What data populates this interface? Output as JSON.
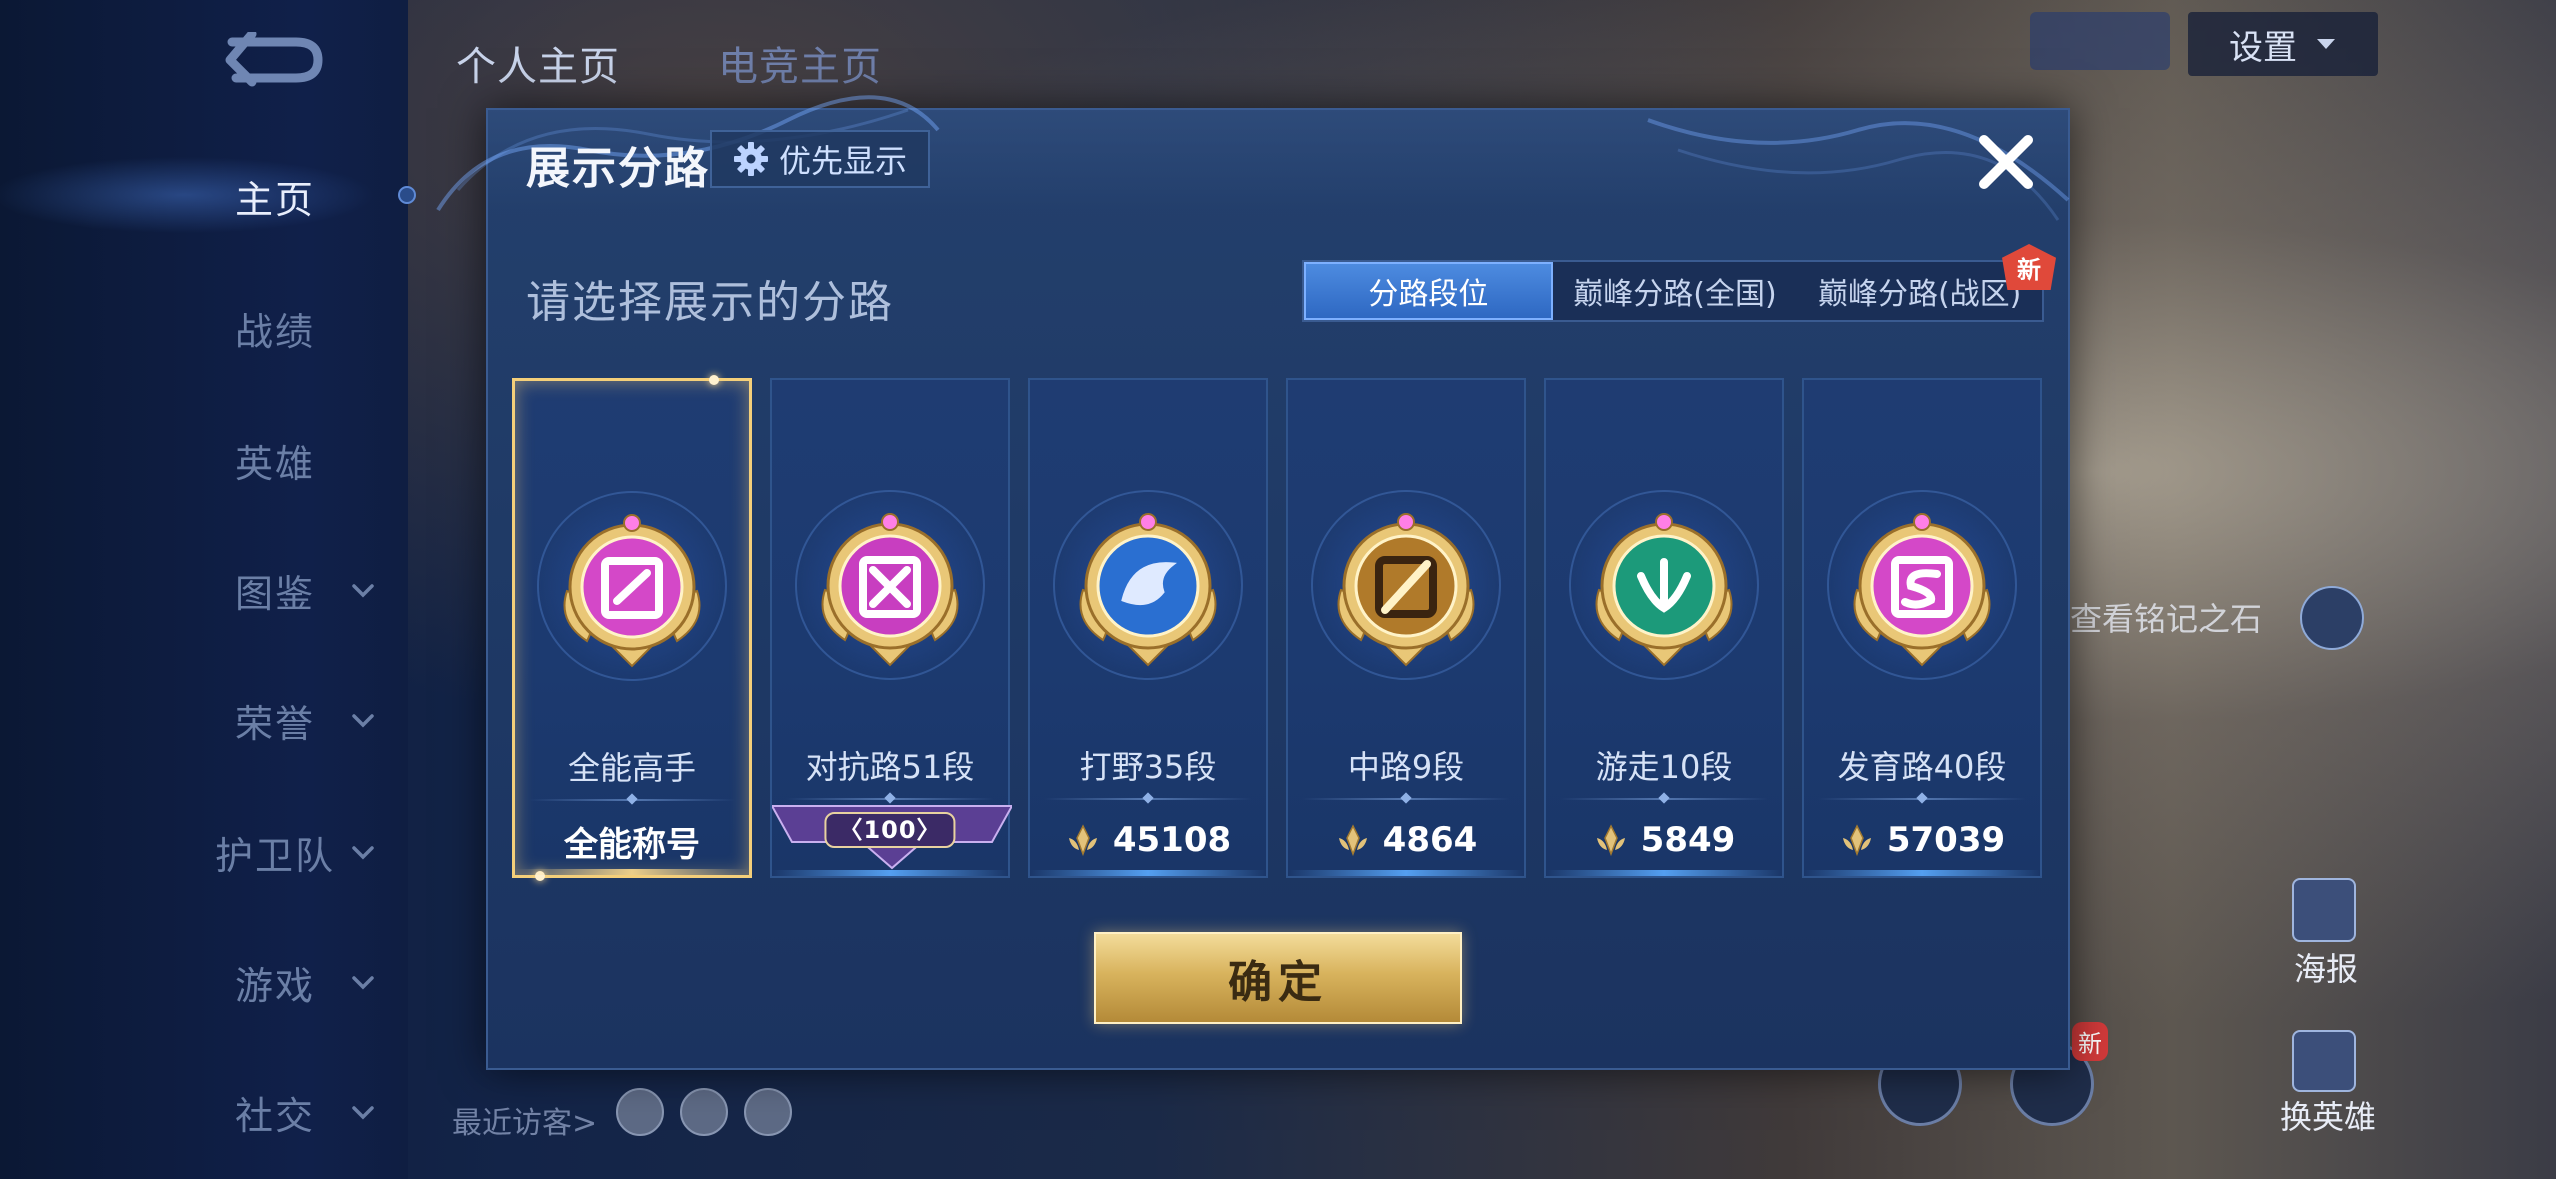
{
  "nav": {
    "top_tabs": [
      "个人主页",
      "电竞主页"
    ],
    "sidebar": [
      {
        "label": "主页",
        "active": true,
        "chevron": false
      },
      {
        "label": "战绩",
        "active": false,
        "chevron": false
      },
      {
        "label": "英雄",
        "active": false,
        "chevron": false
      },
      {
        "label": "图鉴",
        "active": false,
        "chevron": true
      },
      {
        "label": "荣誉",
        "active": false,
        "chevron": true
      },
      {
        "label": "护卫队",
        "active": false,
        "chevron": true
      },
      {
        "label": "游戏",
        "active": false,
        "chevron": true
      },
      {
        "label": "社交",
        "active": false,
        "chevron": true
      }
    ],
    "settings_label": "设置",
    "recent_visitors_label": "最近访客>",
    "hint_label": "查看铭记之石",
    "poster_label": "海报",
    "swap_hero_label": "换英雄",
    "new_small": "新"
  },
  "modal": {
    "title": "展示分路",
    "priority_label": "优先显示",
    "subtitle": "请选择展示的分路",
    "tabs": [
      {
        "label": "分路段位",
        "active": true
      },
      {
        "label": "巅峰分路(全国)",
        "active": false
      },
      {
        "label": "巅峰分路(战区)",
        "active": false,
        "badge": "新"
      }
    ],
    "cards": [
      {
        "role": "全能高手",
        "detail": "全能称号",
        "type": "text",
        "selected": true,
        "emblem": "allround-emblem",
        "color": "#d448c8"
      },
      {
        "role": "对抗路51段",
        "detail": "100",
        "type": "rank",
        "selected": false,
        "emblem": "clash-lane-emblem",
        "color": "#c83ec0"
      },
      {
        "role": "打野35段",
        "detail": "45108",
        "type": "score",
        "selected": false,
        "emblem": "jungle-emblem",
        "color": "#2a6fd1"
      },
      {
        "role": "中路9段",
        "detail": "4864",
        "type": "score",
        "selected": false,
        "emblem": "mid-lane-emblem",
        "color": "#b07a2a"
      },
      {
        "role": "游走10段",
        "detail": "5849",
        "type": "score",
        "selected": false,
        "emblem": "roam-emblem",
        "color": "#1c9a7a"
      },
      {
        "role": "发育路40段",
        "detail": "57039",
        "type": "score",
        "selected": false,
        "emblem": "farm-lane-emblem",
        "color": "#d448c8"
      }
    ],
    "confirm_label": "确定"
  }
}
